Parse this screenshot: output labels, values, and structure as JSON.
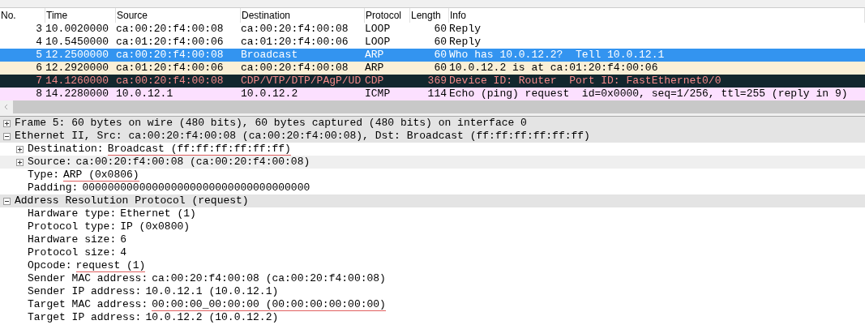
{
  "packet_list": {
    "columns": [
      "No.",
      "Time",
      "Source",
      "Destination",
      "Protocol",
      "Length",
      "Info"
    ],
    "rows": [
      {
        "no": "3",
        "time": "10.0020000",
        "source": "ca:00:20:f4:00:08",
        "destination": "ca:00:20:f4:00:08",
        "protocol": "LOOP",
        "length": "60",
        "info": "Reply",
        "selected": false,
        "color": "#ffffff"
      },
      {
        "no": "4",
        "time": "10.5450000",
        "source": "ca:01:20:f4:00:06",
        "destination": "ca:01:20:f4:00:06",
        "protocol": "LOOP",
        "length": "60",
        "info": "Reply",
        "selected": false,
        "color": "#ffffff"
      },
      {
        "no": "5",
        "time": "12.2500000",
        "source": "ca:00:20:f4:00:08",
        "destination": "Broadcast",
        "protocol": "ARP",
        "length": "60",
        "info": "Who has 10.0.12.2?  Tell 10.0.12.1",
        "selected": true
      },
      {
        "no": "6",
        "time": "12.2920000",
        "source": "ca:01:20:f4:00:06",
        "destination": "ca:00:20:f4:00:08",
        "protocol": "ARP",
        "length": "60",
        "info": "10.0.12.2 is at ca:01:20:f4:00:06",
        "selected": false,
        "color": "#faf0d7"
      },
      {
        "no": "7",
        "time": "14.1260000",
        "source": "ca:00:20:f4:00:08",
        "destination": "CDP/VTP/DTP/PAgP/UD",
        "protocol": "CDP",
        "length": "369",
        "info": "Device ID: Router  Port ID: FastEthernet0/0",
        "selected": false,
        "color": "#12272e"
      },
      {
        "no": "8",
        "time": "14.2280000",
        "source": "10.0.12.1",
        "destination": "10.0.12.2",
        "protocol": "ICMP",
        "length": "114",
        "info": "Echo (ping) request  id=0x0000, seq=1/256, ttl=255 (reply in 9)",
        "selected": false,
        "color": "#fce0ff"
      }
    ]
  },
  "details": [
    {
      "text": "Frame 5: 60 bytes on wire (480 bits), 60 bytes captured (480 bits) on interface 0",
      "expanded": false
    },
    {
      "text": "Ethernet II, Src: ca:00:20:f4:00:08 (ca:00:20:f4:00:08), Dst: Broadcast (ff:ff:ff:ff:ff:ff)",
      "expanded": true,
      "children": [
        {
          "label": "Destination:",
          "value": "Broadcast (ff:ff:ff:ff:ff:ff)",
          "expanded": false,
          "highlighted": false,
          "annotated": true
        },
        {
          "label": "Source:",
          "value": "ca:00:20:f4:00:08 (ca:00:20:f4:00:08)",
          "expanded": false,
          "highlighted": true,
          "annotated": false
        },
        {
          "label": "Type:",
          "value": "ARP (0x0806)",
          "highlighted": false,
          "annotated": true
        },
        {
          "label": "Padding:",
          "value": "000000000000000000000000000000000000",
          "highlighted": false,
          "annotated": false
        }
      ]
    },
    {
      "text": "Address Resolution Protocol (request)",
      "expanded": true,
      "children": [
        {
          "label": "Hardware type:",
          "value": "Ethernet (1)",
          "highlighted": false,
          "annotated": false
        },
        {
          "label": "Protocol type:",
          "value": "IP (0x0800)",
          "highlighted": false,
          "annotated": false
        },
        {
          "label": "Hardware size:",
          "value": "6",
          "highlighted": false,
          "annotated": false
        },
        {
          "label": "Protocol size:",
          "value": "4",
          "highlighted": false,
          "annotated": false
        },
        {
          "label": "Opcode:",
          "value": "request (1)",
          "highlighted": false,
          "annotated": true
        },
        {
          "label": "Sender MAC address:",
          "value": "ca:00:20:f4:00:08 (ca:00:20:f4:00:08)",
          "highlighted": false,
          "annotated": false
        },
        {
          "label": "Sender IP address:",
          "value": "10.0.12.1 (10.0.12.1)",
          "highlighted": false,
          "annotated": false
        },
        {
          "label": "Target MAC address:",
          "value": "00:00:00_00:00:00 (00:00:00:00:00:00)",
          "highlighted": false,
          "annotated": true
        },
        {
          "label": "Target IP address:",
          "value": "10.0.12.2 (10.0.12.2)",
          "highlighted": false,
          "annotated": false
        }
      ]
    }
  ]
}
